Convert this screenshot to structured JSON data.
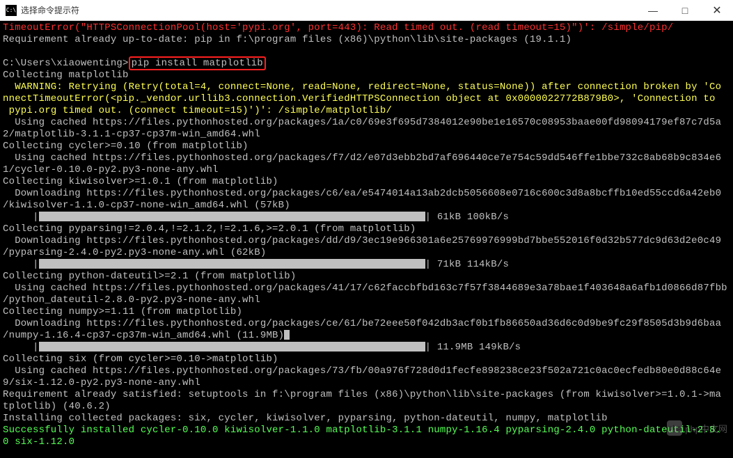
{
  "window": {
    "icon_text": "C:\\",
    "title": "选择命令提示符"
  },
  "terminal": {
    "l1": "TimeoutError(\"HTTPSConnectionPool(host='pypi.org', port=443): Read timed out. (read timeout=15)\")': /simple/pip/",
    "l2": "Requirement already up-to-date: pip in f:\\program files (x86)\\python\\lib\\site-packages (19.1.1)",
    "l3": "",
    "prompt": "C:\\Users\\xiaowenting>",
    "cmd": "pip install matplotlib",
    "l5": "Collecting matplotlib",
    "warn1": "  WARNING: Retrying (Retry(total=4, connect=None, read=None, redirect=None, status=None)) after connection broken by 'Co",
    "warn2": "nnectTimeoutError(<pip._vendor.urllib3.connection.VerifiedHTTPSConnection object at 0x0000022772B879B0>, 'Connection to",
    "warn3": " pypi.org timed out. (connect timeout=15)')': /simple/matplotlib/",
    "l8": "  Using cached https://files.pythonhosted.org/packages/1a/c0/69e3f695d7384012e90be1e16570c08953baae00fd98094179ef87c7d5a",
    "l9": "2/matplotlib-3.1.1-cp37-cp37m-win_amd64.whl",
    "l10": "Collecting cycler>=0.10 (from matplotlib)",
    "l11": "  Using cached https://files.pythonhosted.org/packages/f7/d2/e07d3ebb2bd7af696440ce7e754c59dd546ffe1bbe732c8ab68b9c834e6",
    "l12": "1/cycler-0.10.0-py2.py3-none-any.whl",
    "l13": "Collecting kiwisolver>=1.0.1 (from matplotlib)",
    "l14": "  Downloading https://files.pythonhosted.org/packages/c6/ea/e5474014a13ab2dcb5056608e0716c600c3d8a8bcffb10ed55ccd6a42eb0",
    "l15": "/kiwisolver-1.1.0-cp37-none-win_amd64.whl (57kB)",
    "prog1_stats": " 61kB 100kB/s",
    "l17": "Collecting pyparsing!=2.0.4,!=2.1.2,!=2.1.6,>=2.0.1 (from matplotlib)",
    "l18": "  Downloading https://files.pythonhosted.org/packages/dd/d9/3ec19e966301a6e25769976999bd7bbe552016f0d32b577dc9d63d2e0c49",
    "l19": "/pyparsing-2.4.0-py2.py3-none-any.whl (62kB)",
    "prog2_stats": " 71kB 114kB/s",
    "l21": "Collecting python-dateutil>=2.1 (from matplotlib)",
    "l22": "  Using cached https://files.pythonhosted.org/packages/41/17/c62faccbfbd163c7f57f3844689e3a78bae1f403648a6afb1d0866d87fbb",
    "l23": "/python_dateutil-2.8.0-py2.py3-none-any.whl",
    "l24": "Collecting numpy>=1.11 (from matplotlib)",
    "l25": "  Downloading https://files.pythonhosted.org/packages/ce/61/be72eee50f042db3acf0b1fb86650ad36d6c0d9be9fc29f8505d3b9d6baa",
    "l26": "/numpy-1.16.4-cp37-cp37m-win_amd64.whl (11.9MB)",
    "prog3_stats": " 11.9MB 149kB/s",
    "l28": "Collecting six (from cycler>=0.10->matplotlib)",
    "l29": "  Using cached https://files.pythonhosted.org/packages/73/fb/00a976f728d0d1fecfe898238ce23f502a721c0ac0ecfedb80e0d88c64e",
    "l30": "9/six-1.12.0-py2.py3-none-any.whl",
    "l31": "Requirement already satisfied: setuptools in f:\\program files (x86)\\python\\lib\\site-packages (from kiwisolver>=1.0.1->ma",
    "l32": "tplotlib) (40.6.2)",
    "l33": "Installing collected packages: six, cycler, kiwisolver, pyparsing, python-dateutil, numpy, matplotlib",
    "success1": "Successfully installed cycler-0.10.0 kiwisolver-1.1.0 matplotlib-3.1.1 numpy-1.16.4 pyparsing-2.4.0 python-dateutil-2.8.",
    "success2": "0 six-1.12.0"
  },
  "watermark": {
    "logo": "php",
    "text": "php中文网"
  }
}
